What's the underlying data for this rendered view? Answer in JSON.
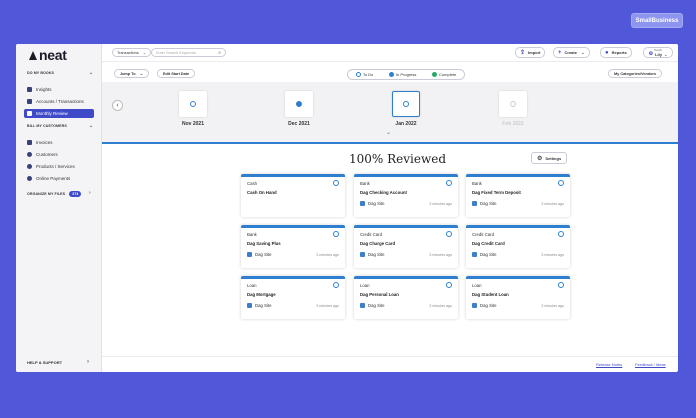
{
  "brand_badge": "SmallBusiness",
  "sidebar": {
    "logo": "neat",
    "sections": {
      "books": "DO MY BOOKS",
      "customers": "BILL MY CUSTOMERS",
      "files": "ORGANIZE MY FILES",
      "help": "HELP & SUPPORT"
    },
    "files_count": "374",
    "items": [
      {
        "label": "Insights"
      },
      {
        "label": "Accounts / Transactions"
      },
      {
        "label": "Monthly Review"
      },
      {
        "label": "Invoices"
      },
      {
        "label": "Customers"
      },
      {
        "label": "Products / Services"
      },
      {
        "label": "Online Payments"
      }
    ]
  },
  "topbar": {
    "scope_select": "Transactions",
    "search_placeholder": "Enter Search Keywords",
    "import_label": "Import",
    "create_label": "Create",
    "reports_label": "Reports",
    "user_label": "Lily",
    "user_sub": "Teach"
  },
  "toolbar": {
    "jump_to": "Jump To",
    "edit_start_date": "Edit Start Date",
    "my_categories": "My Categories/Vendors"
  },
  "legend": {
    "todo": "To Do",
    "in_progress": "In Progress",
    "complete": "Complete"
  },
  "timeline": {
    "months": [
      {
        "label": "Nov 2021"
      },
      {
        "label": "Dec 2021"
      },
      {
        "label": "Jan 2022"
      },
      {
        "label": "Feb 2022"
      }
    ]
  },
  "review": {
    "heading": "100% Reviewed",
    "settings_label": "Settings"
  },
  "cards": [
    {
      "type": "Cash",
      "name": "Cash On Hand",
      "site": "",
      "time": ""
    },
    {
      "type": "Bank",
      "name": "Dag Checking Account",
      "site": "Dag Site",
      "time": "3 minutes ago"
    },
    {
      "type": "Bank",
      "name": "Dag Fixed Term Deposit",
      "site": "Dag Site",
      "time": "3 minutes ago"
    },
    {
      "type": "Bank",
      "name": "Dag Saving Plus",
      "site": "Dag Site",
      "time": "3 minutes ago"
    },
    {
      "type": "Credit Card",
      "name": "Dag Charge Card",
      "site": "Dag Site",
      "time": "3 minutes ago"
    },
    {
      "type": "Credit Card",
      "name": "Dag Credit Card",
      "site": "Dag Site",
      "time": "3 minutes ago"
    },
    {
      "type": "Loan",
      "name": "Dag Mortgage",
      "site": "Dag Site",
      "time": "3 minutes ago"
    },
    {
      "type": "Loan",
      "name": "Dag Personal Loan",
      "site": "Dag Site",
      "time": "3 minutes ago"
    },
    {
      "type": "Loan",
      "name": "Dag Student Loan",
      "site": "Dag Site",
      "time": "3 minutes ago"
    }
  ],
  "footer": {
    "release_notes": "Release Notes",
    "feedback": "Feedback / Ideas"
  },
  "colors": {
    "background": "#5057d9",
    "accent": "#2f7fd1",
    "active_nav": "#3f4ac8"
  }
}
